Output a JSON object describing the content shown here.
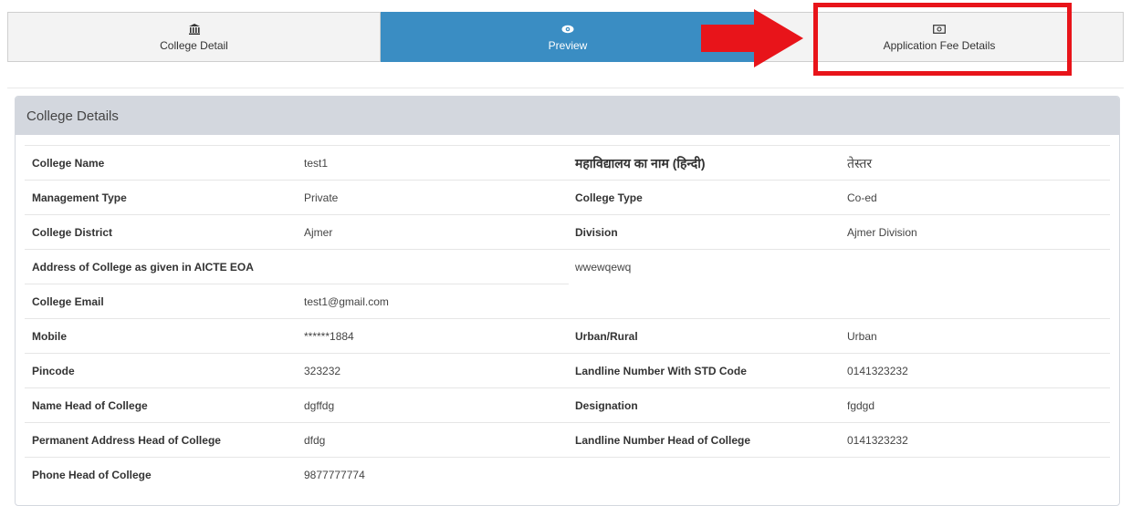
{
  "tabs": [
    {
      "label": "College Detail",
      "icon": "bank-icon"
    },
    {
      "label": "Preview",
      "icon": "eye-icon"
    },
    {
      "label": "Application Fee Details",
      "icon": "money-icon"
    }
  ],
  "colors": {
    "active_tab": "#3a8dc3",
    "highlight": "#e8141a",
    "panel_header": "#d3d7de"
  },
  "panel": {
    "title": "College Details"
  },
  "details": {
    "college_name_label": "College Name",
    "college_name": "test1",
    "college_name_hindi_label": "महाविद्यालय का नाम (हिन्दी)",
    "college_name_hindi": "तेस्तर",
    "management_type_label": "Management Type",
    "management_type": "Private",
    "college_type_label": "College Type",
    "college_type": "Co-ed",
    "college_district_label": "College District",
    "college_district": "Ajmer",
    "division_label": "Division",
    "division": "Ajmer Division",
    "address_label": "Address of College as given in AICTE EOA",
    "address": "wwewqewq",
    "email_label": "College Email",
    "email": "test1@gmail.com",
    "mobile_label": "Mobile",
    "mobile": "******1884",
    "urban_rural_label": "Urban/Rural",
    "urban_rural": "Urban",
    "pincode_label": "Pincode",
    "pincode": "323232",
    "landline_label": "Landline Number With STD Code",
    "landline": "0141323232",
    "head_name_label": "Name Head of College",
    "head_name": "dgffdg",
    "designation_label": "Designation",
    "designation": "fgdgd",
    "head_address_label": "Permanent Address Head of College",
    "head_address": "dfdg",
    "head_landline_label": "Landline Number Head of College",
    "head_landline": "0141323232",
    "head_phone_label": "Phone Head of College",
    "head_phone": "9877777774"
  }
}
